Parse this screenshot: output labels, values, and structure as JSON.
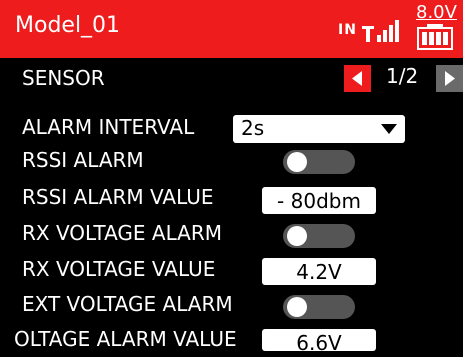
{
  "header": {
    "title": "Model_01",
    "signal_label": "IN",
    "signal_icon": "signal-bars-icon",
    "battery_voltage": "8.0V",
    "battery_icon": "battery-icon"
  },
  "colors": {
    "accent": "#ee1c1c",
    "background": "#000000",
    "toggle_off": "#555555"
  },
  "page": {
    "section_title": "SENSOR",
    "pager": "1/2",
    "prev_icon": "arrow-left-icon",
    "next_icon": "arrow-right-icon"
  },
  "settings": {
    "alarm_interval": {
      "label": "ALARM INTERVAL",
      "value": "2s",
      "icon": "dropdown-arrow-icon"
    },
    "rssi_alarm": {
      "label": "RSSI ALARM",
      "enabled": false
    },
    "rssi_alarm_value": {
      "label": "RSSI ALARM VALUE",
      "value": "- 80dbm"
    },
    "rx_voltage_alarm": {
      "label": "RX VOLTAGE ALARM",
      "enabled": false
    },
    "rx_voltage_value": {
      "label": "RX VOLTAGE VALUE",
      "value": "4.2V"
    },
    "ext_voltage_alarm": {
      "label": "EXT VOLTAGE ALARM",
      "enabled": false
    },
    "ext_voltage_alarm_value": {
      "label": "OLTAGE ALARM VALUE",
      "value": "6.6V"
    }
  }
}
